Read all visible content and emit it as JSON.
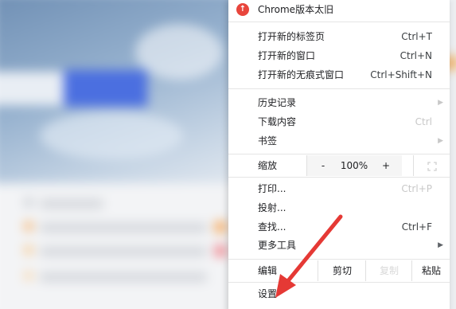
{
  "menu": {
    "update_label": "Chrome版本太旧",
    "new_tab": {
      "label": "打开新的标签页",
      "shortcut": "Ctrl+T"
    },
    "new_window": {
      "label": "打开新的窗口",
      "shortcut": "Ctrl+N"
    },
    "new_incognito": {
      "label": "打开新的无痕式窗口",
      "shortcut": "Ctrl+Shift+N"
    },
    "history": {
      "label": "历史记录"
    },
    "downloads": {
      "label": "下载内容",
      "shortcut": "Ctrl"
    },
    "bookmarks": {
      "label": "书签"
    },
    "zoom": {
      "label": "缩放",
      "minus": "-",
      "value": "100%",
      "plus": "+"
    },
    "print": {
      "label": "打印...",
      "shortcut": "Ctrl+P"
    },
    "cast": {
      "label": "投射..."
    },
    "find": {
      "label": "查找...",
      "shortcut": "Ctrl+F"
    },
    "more_tools": {
      "label": "更多工具"
    },
    "edit": {
      "label": "编辑",
      "cut": "剪切",
      "copy": "复制",
      "paste": "粘贴"
    },
    "settings": {
      "label": "设置"
    }
  },
  "colors": {
    "update_icon": "#e8453c",
    "annotation_arrow": "#e53935",
    "search_button": "#4b6fe0"
  },
  "icons": {
    "update": "up-arrow-icon",
    "submenu": "chevron-right-icon",
    "fullscreen": "fullscreen-icon"
  }
}
